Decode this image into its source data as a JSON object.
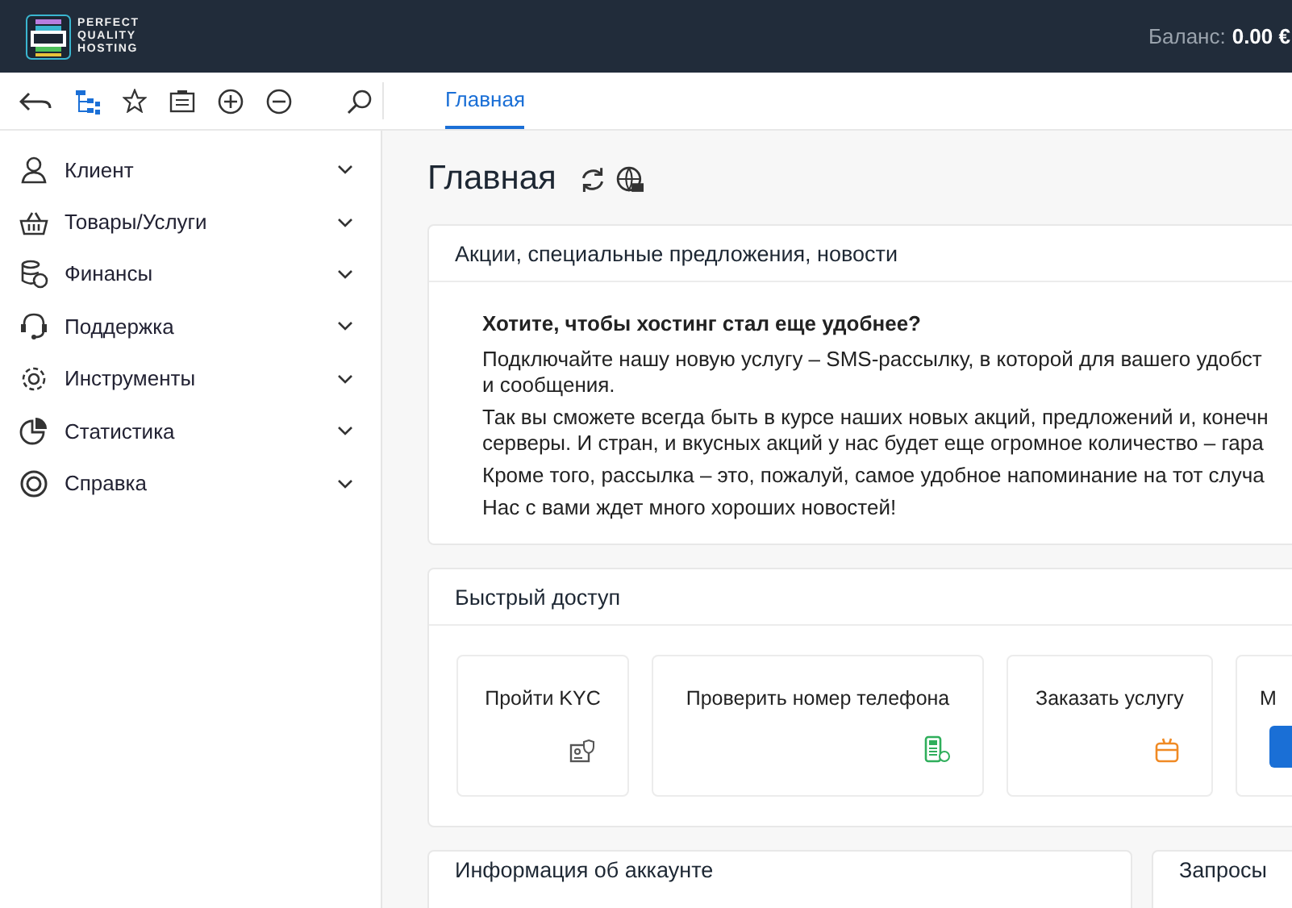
{
  "header": {
    "logo_lines": [
      "PERFECT",
      "QUALITY",
      "HOSTING"
    ],
    "balance_label": "Баланс:",
    "balance_value": "0.00 €"
  },
  "tabs": [
    {
      "label": "Главная",
      "selected": true
    }
  ],
  "sidebar": {
    "items": [
      {
        "label": "Клиент"
      },
      {
        "label": "Товары/Услуги"
      },
      {
        "label": "Финансы"
      },
      {
        "label": "Поддержка"
      },
      {
        "label": "Инструменты"
      },
      {
        "label": "Статистика"
      },
      {
        "label": "Справка"
      }
    ]
  },
  "page": {
    "title": "Главная",
    "news": {
      "title": "Акции, специальные предложения, новости",
      "heading": "Хотите, чтобы хостинг стал еще удобнее?",
      "paragraphs": [
        [
          "Подключайте нашу новую услугу – SMS-рассылку, в которой для вашего удобст",
          "и сообщения."
        ],
        [
          "Так вы сможете всегда быть в курсе наших новых акций, предложений и, конечн",
          "серверы. И стран, и вкусных акций у нас будет еще огромное количество – гара"
        ],
        [
          "Кроме того, рассылка – это, пожалуй, самое удобное напоминание на тот случа"
        ],
        [
          "Нас с вами ждет много хороших новостей!"
        ]
      ]
    },
    "quick_access": {
      "title": "Быстрый доступ",
      "tiles": [
        {
          "label": "Пройти KYC"
        },
        {
          "label": "Проверить номер телефона"
        },
        {
          "label": "Заказать услугу"
        },
        {
          "label": "М"
        }
      ]
    },
    "bottom_cards": [
      {
        "title": "Информация об аккаунте"
      },
      {
        "title": "Запросы"
      }
    ]
  }
}
